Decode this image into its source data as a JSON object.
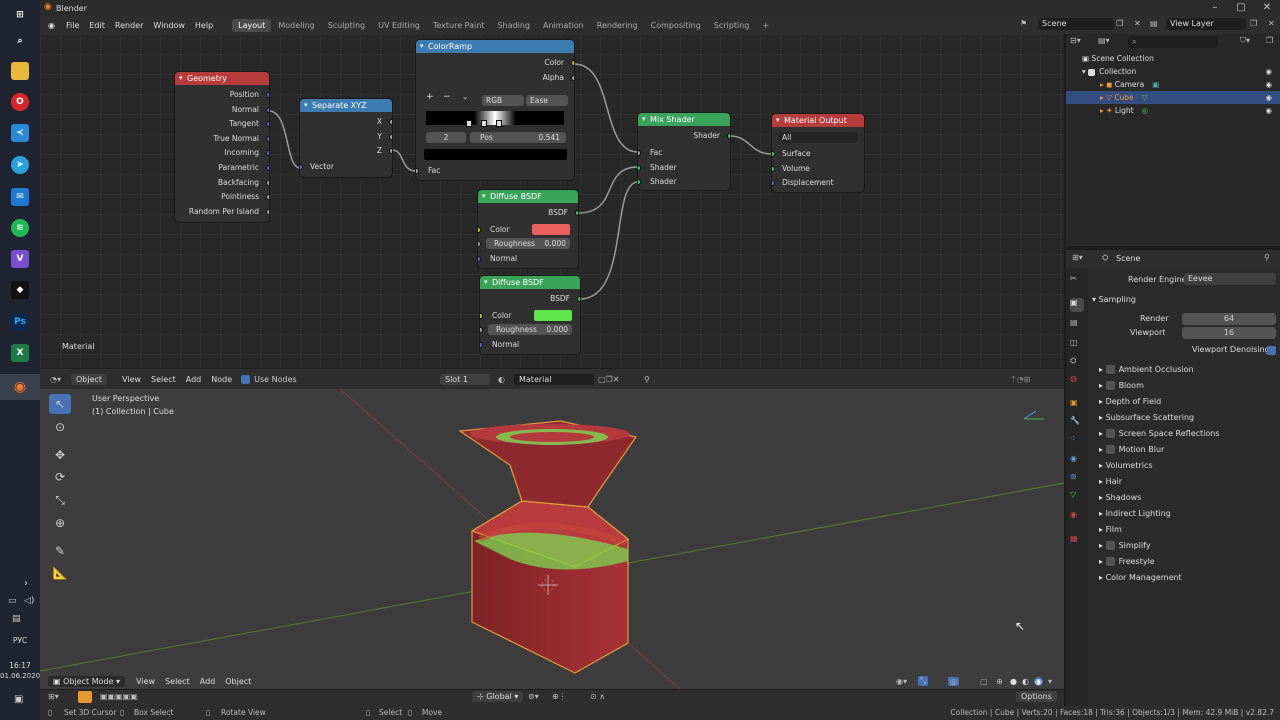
{
  "app_title": "Blender",
  "taskbar": {
    "lang": "РУС",
    "time": "16:17",
    "date": "01.06.2020"
  },
  "menu": {
    "file": "File",
    "edit": "Edit",
    "render": "Render",
    "window": "Window",
    "help": "Help"
  },
  "workspaces": [
    "Layout",
    "Modeling",
    "Sculpting",
    "UV Editing",
    "Texture Paint",
    "Shading",
    "Animation",
    "Rendering",
    "Compositing",
    "Scripting"
  ],
  "scene_name": "Scene",
  "view_layer": "View Layer",
  "nodes": {
    "geometry": {
      "title": "Geometry",
      "outputs": [
        "Position",
        "Normal",
        "Tangent",
        "True Normal",
        "Incoming",
        "Parametric",
        "Backfacing",
        "Pointiness",
        "Random Per Island"
      ]
    },
    "separate": {
      "title": "Separate XYZ",
      "outputs": [
        "X",
        "Y",
        "Z"
      ],
      "input": "Vector"
    },
    "colorramp": {
      "title": "ColorRamp",
      "out_color": "Color",
      "out_alpha": "Alpha",
      "mode": "RGB",
      "interp": "Ease",
      "index": "2",
      "pos_label": "Pos",
      "pos_value": "0.541",
      "input": "Fac"
    },
    "diffuse1": {
      "title": "Diffuse BSDF",
      "output": "BSDF",
      "color_label": "Color",
      "roughness_label": "Roughness",
      "roughness": "0.000",
      "normal": "Normal",
      "color": "#e85f5c"
    },
    "diffuse2": {
      "title": "Diffuse BSDF",
      "output": "BSDF",
      "color_label": "Color",
      "roughness_label": "Roughness",
      "roughness": "0.000",
      "normal": "Normal",
      "color": "#5fe64a"
    },
    "mix": {
      "title": "Mix Shader",
      "output": "Shader",
      "inputs": [
        "Fac",
        "Shader",
        "Shader"
      ]
    },
    "output": {
      "title": "Material Output",
      "target": "All",
      "inputs": [
        "Surface",
        "Volume",
        "Displacement"
      ]
    }
  },
  "node_editor": {
    "label": "Material",
    "header": {
      "object": "Object",
      "view": "View",
      "select": "Select",
      "add": "Add",
      "node": "Node",
      "use_nodes": "Use Nodes",
      "slot": "Slot 1",
      "material": "Material"
    }
  },
  "viewport": {
    "perspective": "User Perspective",
    "collection": "(1) Collection | Cube",
    "mode": "Object Mode",
    "view": "View",
    "select": "Select",
    "add": "Add",
    "object": "Object",
    "orientation": "Global",
    "options": "Options"
  },
  "outliner": {
    "root": "Scene Collection",
    "collection": "Collection",
    "items": [
      "Camera",
      "Cube",
      "Light"
    ]
  },
  "properties": {
    "scene": "Scene",
    "render_engine_label": "Render Engine",
    "render_engine": "Eevee",
    "sampling": "Sampling",
    "render_label": "Render",
    "render_value": "64",
    "viewport_label": "Viewport",
    "viewport_value": "16",
    "denoise": "Viewport Denoising",
    "panels": [
      {
        "label": "Ambient Occlusion",
        "check": true
      },
      {
        "label": "Bloom",
        "check": true
      },
      {
        "label": "Depth of Field",
        "check": false
      },
      {
        "label": "Subsurface Scattering",
        "check": false
      },
      {
        "label": "Screen Space Reflections",
        "check": true
      },
      {
        "label": "Motion Blur",
        "check": true
      },
      {
        "label": "Volumetrics",
        "check": false
      },
      {
        "label": "Hair",
        "check": false
      },
      {
        "label": "Shadows",
        "check": false
      },
      {
        "label": "Indirect Lighting",
        "check": false
      },
      {
        "label": "Film",
        "check": false
      },
      {
        "label": "Simplify",
        "check": true
      },
      {
        "label": "Freestyle",
        "check": true
      },
      {
        "label": "Color Management",
        "check": false
      }
    ]
  },
  "status": {
    "set_cursor": "Set 3D Cursor",
    "box_select": "Box Select",
    "rotate": "Rotate View",
    "select": "Select",
    "move": "Move",
    "info": "Collection | Cube | Verts:20 | Faces:18 | Tris:36 | Objects:1/3 | Mem: 42.9 MiB | v2.82.7"
  }
}
